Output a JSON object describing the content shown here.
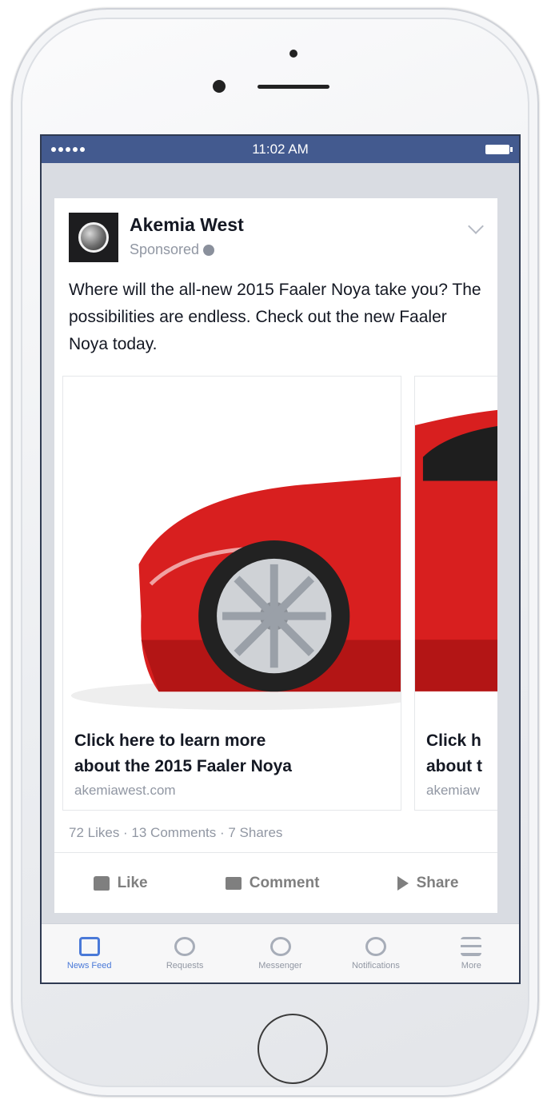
{
  "status_bar": {
    "time": "11:02 AM"
  },
  "post": {
    "page_name": "Akemia West",
    "sponsored_label": "Sponsored",
    "text": "Where will the all-new 2015 Faaler Noya take you? The possibilities are endless. Check out the new Faaler Noya today.",
    "carousel": [
      {
        "title": "Click here to learn more\nabout the 2015 Faaler Noya",
        "url": "akemiawest.com"
      },
      {
        "title": "Click h\nabout t",
        "url": "akemiaw"
      }
    ],
    "counts": "72 Likes · 13 Comments · 7 Shares",
    "actions": {
      "like": "Like",
      "comment": "Comment",
      "share": "Share"
    }
  },
  "tab_bar": {
    "tabs": [
      {
        "label": "News Feed",
        "icon": "news-feed-icon",
        "active": true
      },
      {
        "label": "Requests",
        "icon": "requests-icon"
      },
      {
        "label": "Messenger",
        "icon": "messenger-icon"
      },
      {
        "label": "Notifications",
        "icon": "globe-icon"
      },
      {
        "label": "More",
        "icon": "menu-icon"
      }
    ]
  },
  "colors": {
    "header": "#435a8f",
    "accent": "#4a79d8",
    "car": "#d81f1f"
  }
}
